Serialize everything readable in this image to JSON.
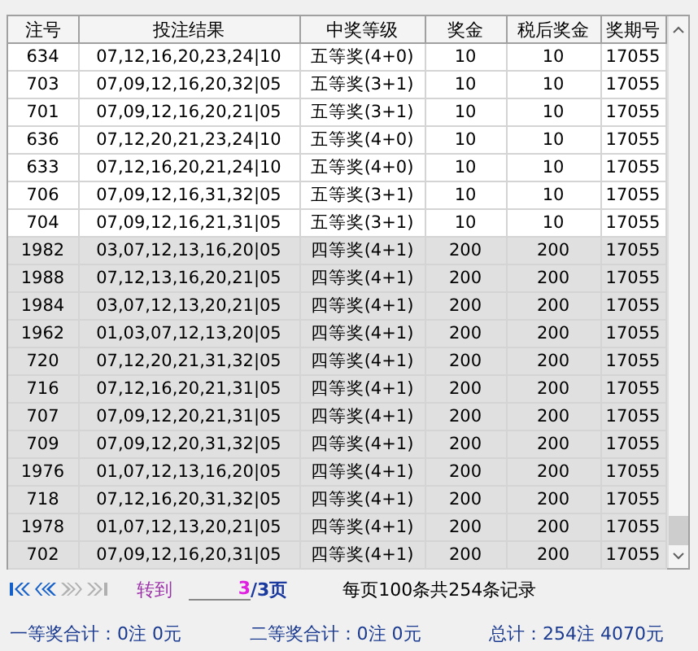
{
  "table": {
    "columns": [
      "注号",
      "投注结果",
      "中奖等级",
      "奖金",
      "税后奖金",
      "奖期号"
    ],
    "rows": [
      {
        "cells": [
          "634",
          "07,12,16,20,23,24|10",
          "五等奖(4+0)",
          "10",
          "10",
          "17055"
        ],
        "selected": false
      },
      {
        "cells": [
          "703",
          "07,09,12,16,20,32|05",
          "五等奖(3+1)",
          "10",
          "10",
          "17055"
        ],
        "selected": false
      },
      {
        "cells": [
          "701",
          "07,09,12,16,20,21|05",
          "五等奖(3+1)",
          "10",
          "10",
          "17055"
        ],
        "selected": false
      },
      {
        "cells": [
          "636",
          "07,12,20,21,23,24|10",
          "五等奖(4+0)",
          "10",
          "10",
          "17055"
        ],
        "selected": false
      },
      {
        "cells": [
          "633",
          "07,12,16,20,21,24|10",
          "五等奖(4+0)",
          "10",
          "10",
          "17055"
        ],
        "selected": false
      },
      {
        "cells": [
          "706",
          "07,09,12,16,31,32|05",
          "五等奖(3+1)",
          "10",
          "10",
          "17055"
        ],
        "selected": false
      },
      {
        "cells": [
          "704",
          "07,09,12,16,21,31|05",
          "五等奖(3+1)",
          "10",
          "10",
          "17055"
        ],
        "selected": false
      },
      {
        "cells": [
          "1982",
          "03,07,12,13,16,20|05",
          "四等奖(4+1)",
          "200",
          "200",
          "17055"
        ],
        "selected": true
      },
      {
        "cells": [
          "1988",
          "07,12,13,16,20,21|05",
          "四等奖(4+1)",
          "200",
          "200",
          "17055"
        ],
        "selected": true
      },
      {
        "cells": [
          "1984",
          "03,07,12,13,20,21|05",
          "四等奖(4+1)",
          "200",
          "200",
          "17055"
        ],
        "selected": true
      },
      {
        "cells": [
          "1962",
          "01,03,07,12,13,20|05",
          "四等奖(4+1)",
          "200",
          "200",
          "17055"
        ],
        "selected": true
      },
      {
        "cells": [
          "720",
          "07,12,20,21,31,32|05",
          "四等奖(4+1)",
          "200",
          "200",
          "17055"
        ],
        "selected": true
      },
      {
        "cells": [
          "716",
          "07,12,16,20,21,31|05",
          "四等奖(4+1)",
          "200",
          "200",
          "17055"
        ],
        "selected": true
      },
      {
        "cells": [
          "707",
          "07,09,12,20,21,31|05",
          "四等奖(4+1)",
          "200",
          "200",
          "17055"
        ],
        "selected": true
      },
      {
        "cells": [
          "709",
          "07,09,12,20,31,32|05",
          "四等奖(4+1)",
          "200",
          "200",
          "17055"
        ],
        "selected": true
      },
      {
        "cells": [
          "1976",
          "01,07,12,13,16,20|05",
          "四等奖(4+1)",
          "200",
          "200",
          "17055"
        ],
        "selected": true
      },
      {
        "cells": [
          "718",
          "07,12,16,20,31,32|05",
          "四等奖(4+1)",
          "200",
          "200",
          "17055"
        ],
        "selected": true
      },
      {
        "cells": [
          "1978",
          "01,07,12,13,20,21|05",
          "四等奖(4+1)",
          "200",
          "200",
          "17055"
        ],
        "selected": true
      },
      {
        "cells": [
          "702",
          "07,09,12,16,20,31|05",
          "四等奖(4+1)",
          "200",
          "200",
          "17055"
        ],
        "selected": true
      }
    ]
  },
  "pager": {
    "nav": [
      {
        "kind": "first",
        "disabled": false
      },
      {
        "kind": "prev",
        "disabled": false
      },
      {
        "kind": "next",
        "disabled": true
      },
      {
        "kind": "last",
        "disabled": true
      }
    ],
    "goto_label": "转到",
    "page_value": "3",
    "page_total": "/3页",
    "info": "每页100条共254条记录"
  },
  "summary": [
    "一等奖合计：0注 0元",
    "二等奖合计：0注 0元",
    "总计：254注 4070元"
  ]
}
